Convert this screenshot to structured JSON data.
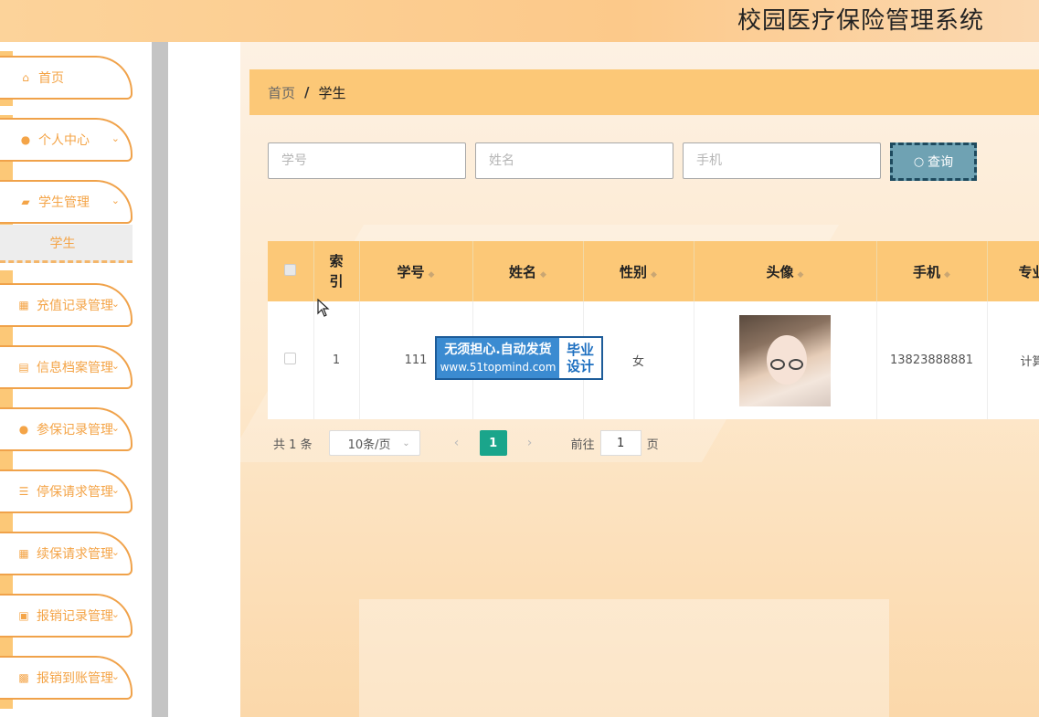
{
  "header": {
    "title": "校园医疗保险管理系统"
  },
  "sidebar": {
    "items": [
      {
        "label": "首页",
        "icon": "home-icon",
        "glyph": "⌂",
        "has_submenu": false
      },
      {
        "label": "个人中心",
        "icon": "user-icon",
        "glyph": "●",
        "has_submenu": true
      },
      {
        "label": "学生管理",
        "icon": "ticket-icon",
        "glyph": "▰",
        "has_submenu": true
      },
      {
        "label": "充值记录管理",
        "icon": "grid-icon",
        "glyph": "▦",
        "has_submenu": true
      },
      {
        "label": "信息档案管理",
        "icon": "doc-icon",
        "glyph": "▤",
        "has_submenu": true
      },
      {
        "label": "参保记录管理",
        "icon": "user-icon",
        "glyph": "●",
        "has_submenu": true
      },
      {
        "label": "停保请求管理",
        "icon": "list-icon",
        "glyph": "☰",
        "has_submenu": true
      },
      {
        "label": "续保请求管理",
        "icon": "grid-icon",
        "glyph": "▦",
        "has_submenu": true
      },
      {
        "label": "报销记录管理",
        "icon": "clipboard-icon",
        "glyph": "▣",
        "has_submenu": true
      },
      {
        "label": "报销到账管理",
        "icon": "chart-icon",
        "glyph": "▩",
        "has_submenu": true
      }
    ],
    "submenu_label": "学生"
  },
  "breadcrumb": {
    "home": "首页",
    "separator": "/",
    "current": "学生"
  },
  "search": {
    "student_no_placeholder": "学号",
    "name_placeholder": "姓名",
    "phone_placeholder": "手机",
    "button_label": "查询"
  },
  "table": {
    "headers": {
      "index": "索\n引",
      "student_no": "学号",
      "name": "姓名",
      "gender": "性别",
      "avatar": "头像",
      "phone": "手机",
      "major": "专业"
    },
    "rows": [
      {
        "index": "1",
        "student_no": "111",
        "name": "",
        "gender": "女",
        "phone": "13823888881",
        "major": "计算"
      }
    ]
  },
  "watermark": {
    "line1": "无须担心.自动发货",
    "line2": "www.51topmind.com",
    "right": "毕业\n设计"
  },
  "pagination": {
    "total_prefix": "共",
    "total": "1",
    "total_suffix": "条",
    "page_size": "10条/页",
    "current_page": "1",
    "goto_prefix": "前往",
    "goto_value": "1",
    "goto_suffix": "页"
  },
  "colors": {
    "accent": "#fcc877",
    "menu_border": "#f0a24a",
    "menu_text": "#f4a447",
    "search_button": "#6fa2b3",
    "pager_active": "#1aa58b"
  }
}
